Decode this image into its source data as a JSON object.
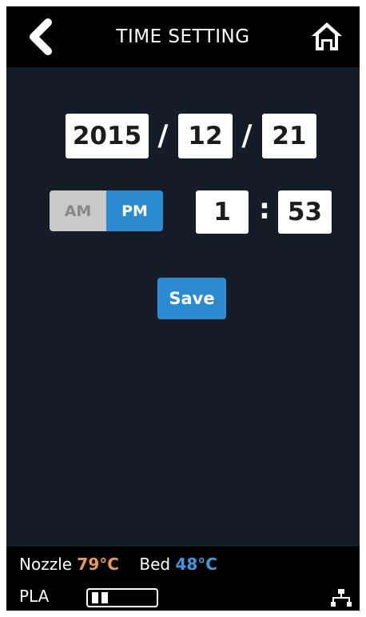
{
  "header": {
    "title": "TIME SETTING",
    "back_icon": "chevron-left-icon",
    "home_icon": "home-icon"
  },
  "date": {
    "year": "2015",
    "month": "12",
    "day": "21",
    "separator": "/"
  },
  "time": {
    "am_label": "AM",
    "pm_label": "PM",
    "selected": "PM",
    "hour": "1",
    "minute": "53",
    "separator": ":"
  },
  "actions": {
    "save_label": "Save"
  },
  "status": {
    "nozzle_label": "Nozzle",
    "nozzle_temp": "79°C",
    "bed_label": "Bed",
    "bed_temp": "48°C",
    "material": "PLA",
    "network_icon": "network-icon"
  },
  "colors": {
    "background": "#141c28",
    "accent": "#2a8bd3",
    "nozzle": "#e89a4e",
    "bed": "#3a9ae0"
  }
}
